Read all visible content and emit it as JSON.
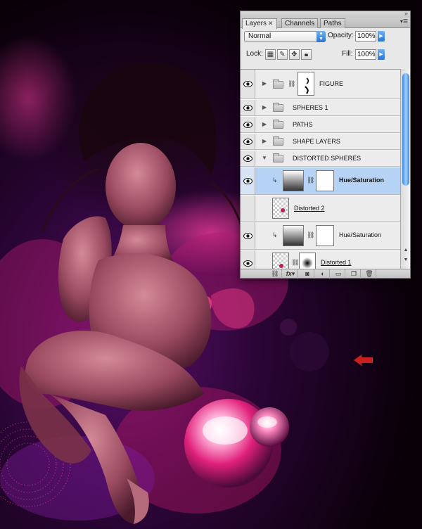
{
  "panel": {
    "tabs": [
      {
        "label": "Layers",
        "active": true
      },
      {
        "label": "Channels",
        "active": false
      },
      {
        "label": "Paths",
        "active": false
      }
    ],
    "blend_mode": "Normal",
    "opacity_label": "Opacity:",
    "opacity_value": "100%",
    "lock_label": "Lock:",
    "fill_label": "Fill:",
    "fill_value": "100%",
    "layers": [
      {
        "name": "FIGURE",
        "type": "group-with-mask",
        "expanded": false,
        "visible": true
      },
      {
        "name": "SPHERES 1",
        "type": "group",
        "expanded": false,
        "visible": true
      },
      {
        "name": "PATHS",
        "type": "group",
        "expanded": false,
        "visible": true
      },
      {
        "name": "SHAPE LAYERS",
        "type": "group",
        "expanded": false,
        "visible": true
      },
      {
        "name": "DISTORTED SPHERES",
        "type": "group",
        "expanded": true,
        "visible": true
      },
      {
        "name": "Hue/Saturation",
        "type": "adjustment",
        "selected": true,
        "visible": true
      },
      {
        "name": "Distorted 2",
        "type": "pixel",
        "visible": false
      },
      {
        "name": "Hue/Saturation",
        "type": "adjustment",
        "selected": false,
        "visible": true
      },
      {
        "name": "Distorted 1",
        "type": "pixel-with-mask",
        "visible": true
      }
    ],
    "bottom_buttons": [
      "link-icon",
      "fx-icon",
      "mask-icon",
      "adjustment-icon",
      "new-group-icon",
      "new-layer-icon",
      "trash-icon"
    ],
    "fx_label": "fx",
    "colors": {
      "selected_row": "#b6d3f5",
      "accent_blue": "#2a74d6"
    }
  },
  "artwork": {
    "colors": {
      "background": "#0a0008",
      "magenta": "#d0207a",
      "purple": "#6a1a9a",
      "arrow": "#c81e1e"
    }
  }
}
